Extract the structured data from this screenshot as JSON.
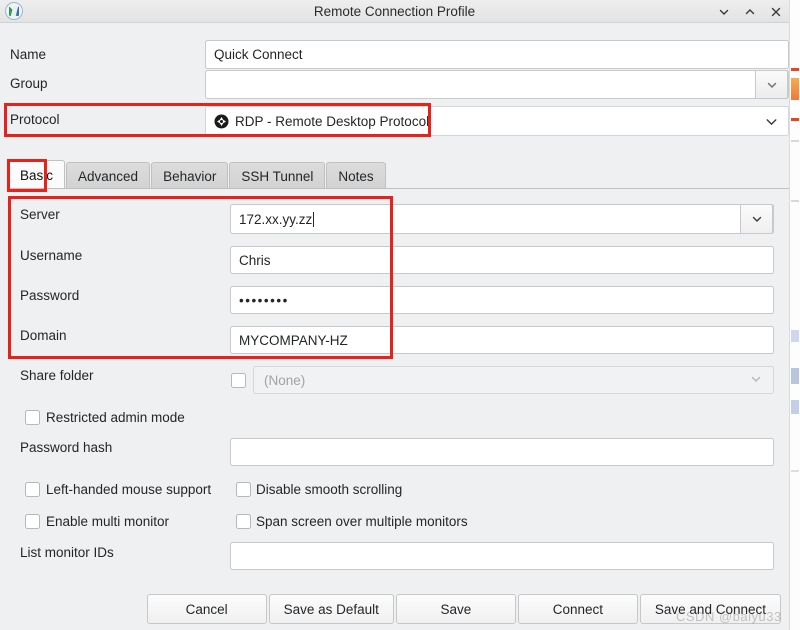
{
  "window": {
    "title": "Remote Connection Profile",
    "app_icon": "remmina-logo-icon",
    "controls": [
      {
        "name": "minimize-button",
        "glyph": "chevron-down-icon"
      },
      {
        "name": "maximize-button",
        "glyph": "chevron-up-icon"
      },
      {
        "name": "close-button",
        "glyph": "close-x-icon"
      }
    ]
  },
  "form": {
    "name": {
      "label": "Name",
      "value": "Quick Connect"
    },
    "group": {
      "label": "Group",
      "value": ""
    },
    "protocol": {
      "label": "Protocol",
      "value": "RDP - Remote Desktop Protocol",
      "icon": "rdp-protocol-icon"
    }
  },
  "tabs": [
    {
      "label": "Basic",
      "active": true
    },
    {
      "label": "Advanced",
      "active": false
    },
    {
      "label": "Behavior",
      "active": false
    },
    {
      "label": "SSH Tunnel",
      "active": false
    },
    {
      "label": "Notes",
      "active": false
    }
  ],
  "basic": {
    "server": {
      "label": "Server",
      "value": "172.xx.yy.zz",
      "focused": true
    },
    "username": {
      "label": "Username",
      "value": "Chris"
    },
    "password": {
      "label": "Password",
      "value": "••••••••"
    },
    "domain": {
      "label": "Domain",
      "value": "MYCOMPANY-HZ"
    },
    "share_folder": {
      "label": "Share folder",
      "checked": false,
      "dropdown_value": "(None)",
      "disabled": true
    },
    "restricted_admin_mode": {
      "label": "Restricted admin mode",
      "checked": false
    },
    "password_hash": {
      "label": "Password hash",
      "value": ""
    },
    "left_handed_mouse": {
      "label": "Left-handed mouse support",
      "checked": false
    },
    "disable_smooth_scrolling": {
      "label": "Disable smooth scrolling",
      "checked": false
    },
    "enable_multi_monitor": {
      "label": "Enable multi monitor",
      "checked": false
    },
    "span_screen": {
      "label": "Span screen over multiple monitors",
      "checked": false
    },
    "list_monitor_ids": {
      "label": "List monitor IDs",
      "value": ""
    }
  },
  "buttons": [
    {
      "name": "cancel-button",
      "label": "Cancel"
    },
    {
      "name": "save-as-default-button",
      "label": "Save as Default"
    },
    {
      "name": "save-button",
      "label": "Save"
    },
    {
      "name": "connect-button",
      "label": "Connect"
    },
    {
      "name": "save-and-connect-button",
      "label": "Save and Connect"
    }
  ],
  "annotations": {
    "color": "#e8221b",
    "boxes": [
      "protocol-row-highlight",
      "basic-tab-highlight",
      "credentials-group-highlight"
    ]
  },
  "watermark": {
    "text": "CSDN @baiyu33"
  }
}
